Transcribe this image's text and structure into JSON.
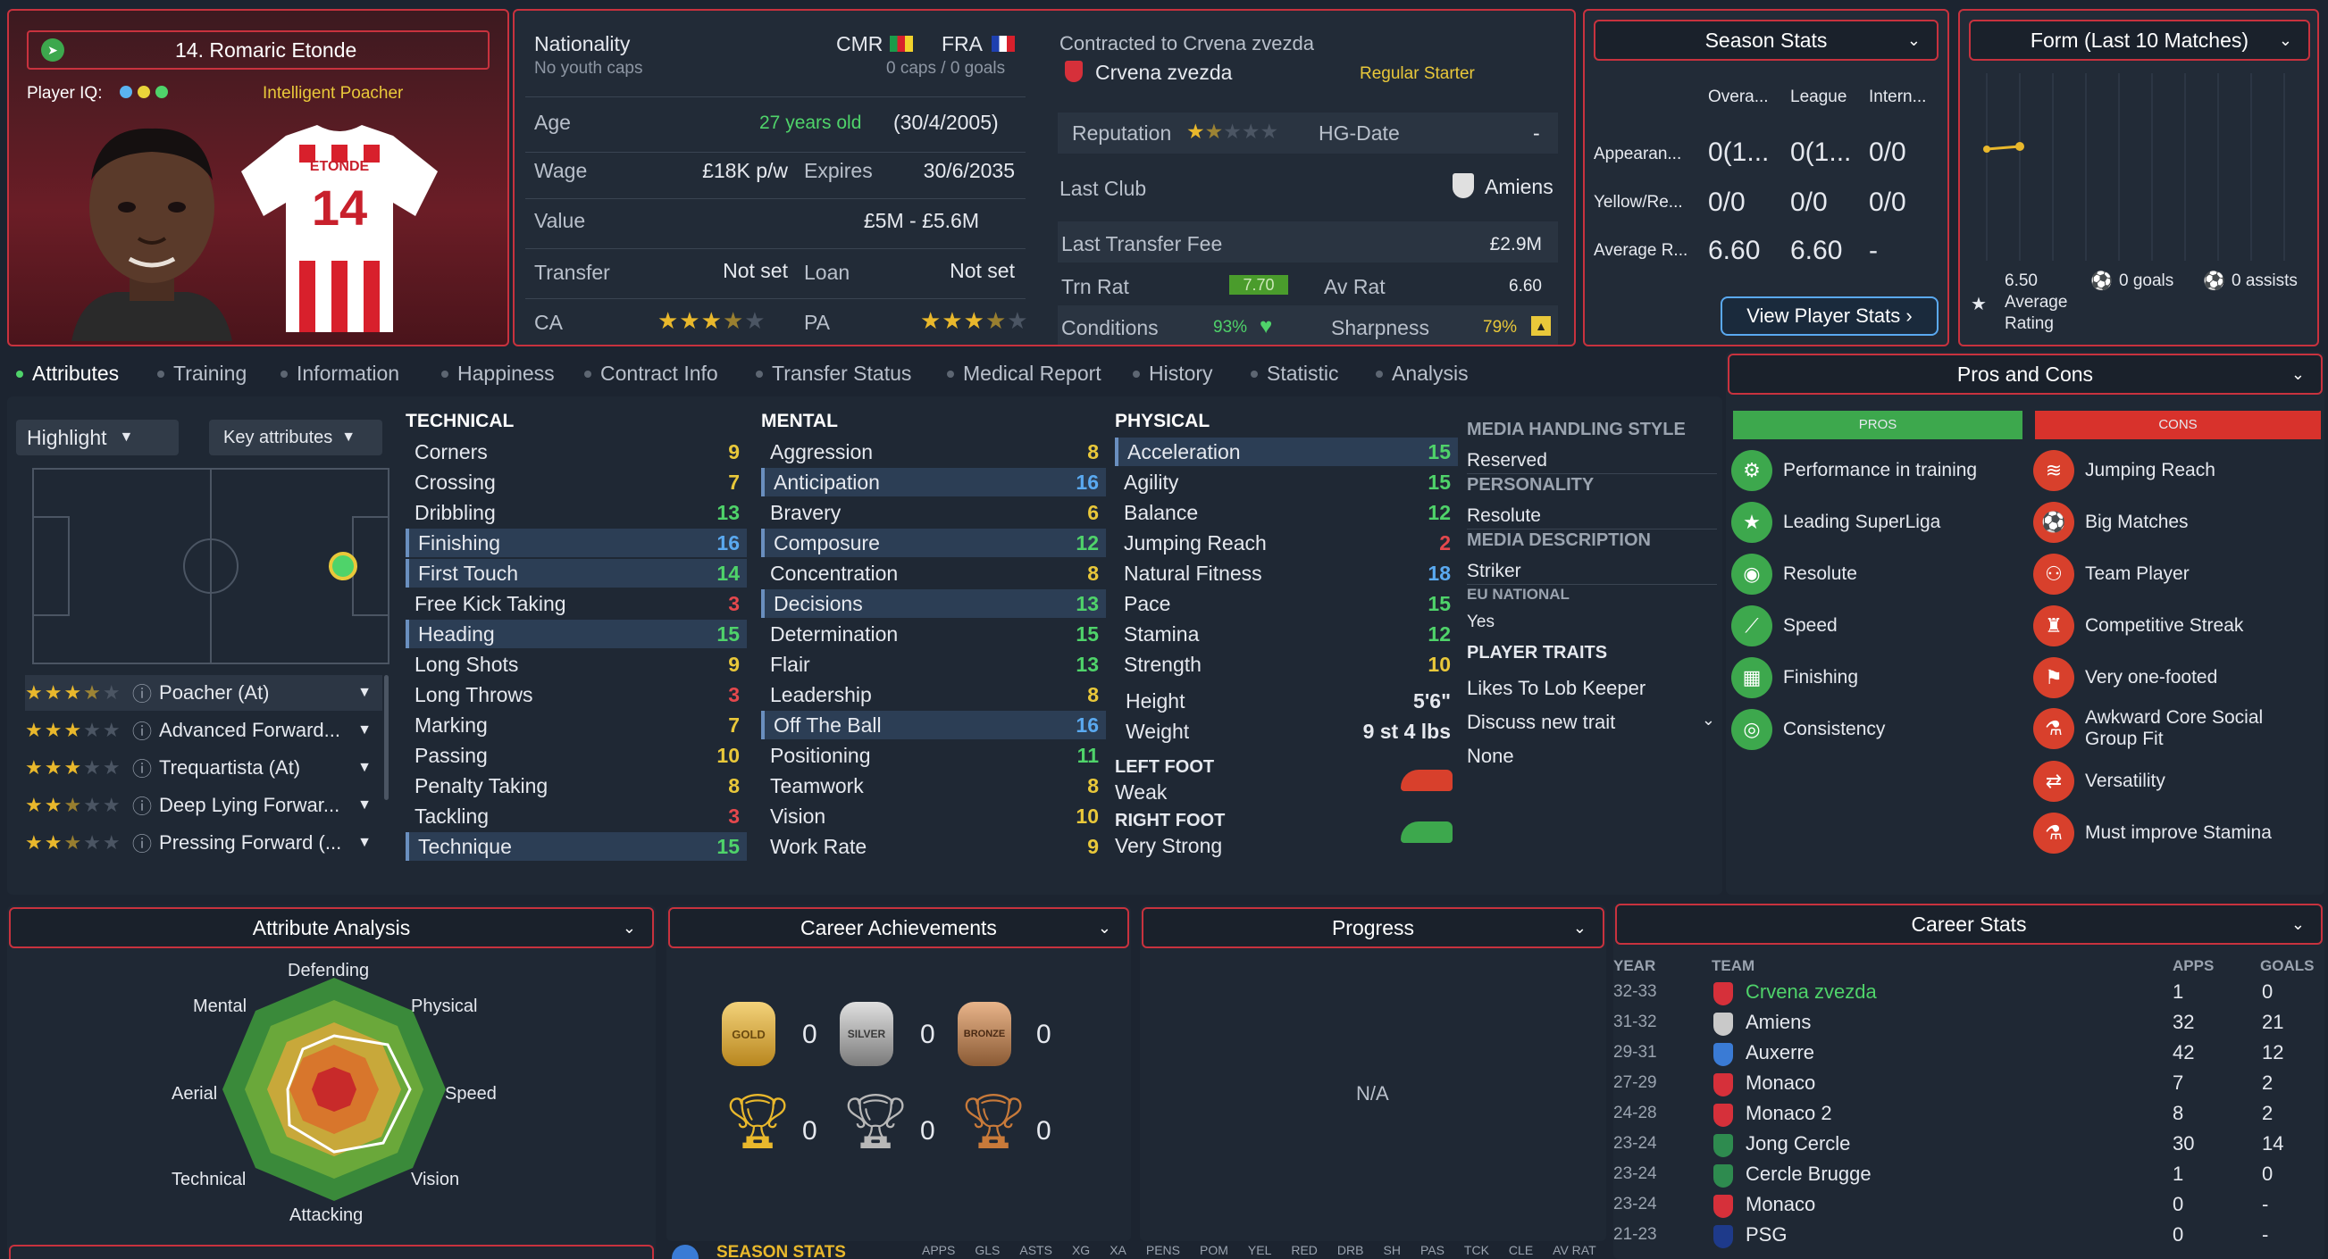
{
  "player": {
    "name": "14. Romaric Etonde",
    "player_iq_label": "Player IQ:",
    "iq_role": "Intelligent Poacher",
    "shirt_name": "ETONDE",
    "shirt_number": "14"
  },
  "bio": {
    "nationality_label": "Nationality",
    "youth_caps": "No youth caps",
    "nat1": "CMR",
    "nat2": "FRA",
    "caps": "0 caps / 0 goals",
    "age_label": "Age",
    "age": "27 years old",
    "dob": "(30/4/2005)",
    "wage_label": "Wage",
    "wage": "£18K p/w",
    "expires_label": "Expires",
    "expires": "30/6/2035",
    "value_label": "Value",
    "value": "£5M - £5.6M",
    "transfer_label": "Transfer",
    "transfer": "Not set",
    "loan_label": "Loan",
    "loan": "Not set",
    "ca_label": "CA",
    "ca_stars": 3.5,
    "pa_label": "PA",
    "pa_stars": 3.5
  },
  "contract": {
    "contracted_label": "Contracted to Crvena zvezda",
    "club": "Crvena zvezda",
    "status": "Regular Starter",
    "reputation_label": "Reputation",
    "reputation_stars": 1.5,
    "hg_label": "HG-Date",
    "hg_value": "-",
    "last_club_label": "Last Club",
    "last_club": "Amiens",
    "last_fee_label": "Last Transfer Fee",
    "last_fee": "£2.9M",
    "trn_rat_label": "Trn Rat",
    "trn_rat": "7.70",
    "av_rat_label": "Av Rat",
    "av_rat": "6.60",
    "conditions_label": "Conditions",
    "conditions": "93%",
    "sharpness_label": "Sharpness",
    "sharpness": "79%"
  },
  "season_stats": {
    "title": "Season Stats",
    "cols": [
      "Overa...",
      "League",
      "Intern..."
    ],
    "rows": [
      {
        "label": "Appearan...",
        "vals": [
          "0(1...",
          "0(1...",
          "0/0"
        ]
      },
      {
        "label": "Yellow/Re...",
        "vals": [
          "0/0",
          "0/0",
          "0/0"
        ]
      },
      {
        "label": "Average R...",
        "vals": [
          "6.60",
          "6.60",
          "-"
        ]
      }
    ],
    "button": "View Player Stats"
  },
  "form": {
    "title": "Form (Last 10 Matches)",
    "rating": "6.50",
    "rating_label1": "Average",
    "rating_label2": "Rating",
    "goals": "0 goals",
    "assists": "0 assists",
    "points": [
      6.5
    ]
  },
  "tabs": [
    "Attributes",
    "Training",
    "Information",
    "Happiness",
    "Contract Info",
    "Transfer Status",
    "Medical Report",
    "History",
    "Statistic",
    "Analysis"
  ],
  "controls": {
    "highlight": "Highlight",
    "key_attributes": "Key attributes"
  },
  "roles": [
    {
      "stars": 3.5,
      "name": "Poacher (At)"
    },
    {
      "stars": 3,
      "name": "Advanced Forward..."
    },
    {
      "stars": 3,
      "name": "Trequartista (At)"
    },
    {
      "stars": 2.5,
      "name": "Deep Lying Forwar..."
    },
    {
      "stars": 2.5,
      "name": "Pressing Forward (..."
    }
  ],
  "technical": {
    "title": "TECHNICAL",
    "items": [
      {
        "n": "Corners",
        "v": "9",
        "c": "y",
        "h": false
      },
      {
        "n": "Crossing",
        "v": "7",
        "c": "y",
        "h": false
      },
      {
        "n": "Dribbling",
        "v": "13",
        "c": "g",
        "h": false
      },
      {
        "n": "Finishing",
        "v": "16",
        "c": "b",
        "h": true
      },
      {
        "n": "First Touch",
        "v": "14",
        "c": "g",
        "h": true
      },
      {
        "n": "Free Kick Taking",
        "v": "3",
        "c": "r",
        "h": false
      },
      {
        "n": "Heading",
        "v": "15",
        "c": "g",
        "h": true
      },
      {
        "n": "Long Shots",
        "v": "9",
        "c": "y",
        "h": false
      },
      {
        "n": "Long Throws",
        "v": "3",
        "c": "r",
        "h": false
      },
      {
        "n": "Marking",
        "v": "7",
        "c": "y",
        "h": false
      },
      {
        "n": "Passing",
        "v": "10",
        "c": "y",
        "h": false
      },
      {
        "n": "Penalty Taking",
        "v": "8",
        "c": "y",
        "h": false
      },
      {
        "n": "Tackling",
        "v": "3",
        "c": "r",
        "h": false
      },
      {
        "n": "Technique",
        "v": "15",
        "c": "g",
        "h": true
      }
    ]
  },
  "mental": {
    "title": "MENTAL",
    "items": [
      {
        "n": "Aggression",
        "v": "8",
        "c": "y",
        "h": false
      },
      {
        "n": "Anticipation",
        "v": "16",
        "c": "b",
        "h": true
      },
      {
        "n": "Bravery",
        "v": "6",
        "c": "y",
        "h": false
      },
      {
        "n": "Composure",
        "v": "12",
        "c": "g",
        "h": true
      },
      {
        "n": "Concentration",
        "v": "8",
        "c": "y",
        "h": false
      },
      {
        "n": "Decisions",
        "v": "13",
        "c": "g",
        "h": true
      },
      {
        "n": "Determination",
        "v": "15",
        "c": "g",
        "h": false
      },
      {
        "n": "Flair",
        "v": "13",
        "c": "g",
        "h": false
      },
      {
        "n": "Leadership",
        "v": "8",
        "c": "y",
        "h": false
      },
      {
        "n": "Off The Ball",
        "v": "16",
        "c": "b",
        "h": true
      },
      {
        "n": "Positioning",
        "v": "11",
        "c": "g",
        "h": false
      },
      {
        "n": "Teamwork",
        "v": "8",
        "c": "y",
        "h": false
      },
      {
        "n": "Vision",
        "v": "10",
        "c": "y",
        "h": false
      },
      {
        "n": "Work Rate",
        "v": "9",
        "c": "y",
        "h": false
      }
    ]
  },
  "physical": {
    "title": "PHYSICAL",
    "items": [
      {
        "n": "Acceleration",
        "v": "15",
        "c": "g",
        "h": true
      },
      {
        "n": "Agility",
        "v": "15",
        "c": "g",
        "h": false
      },
      {
        "n": "Balance",
        "v": "12",
        "c": "g",
        "h": false
      },
      {
        "n": "Jumping Reach",
        "v": "2",
        "c": "r",
        "h": false
      },
      {
        "n": "Natural Fitness",
        "v": "18",
        "c": "b",
        "h": false
      },
      {
        "n": "Pace",
        "v": "15",
        "c": "g",
        "h": false
      },
      {
        "n": "Stamina",
        "v": "12",
        "c": "g",
        "h": false
      },
      {
        "n": "Strength",
        "v": "10",
        "c": "y",
        "h": false
      }
    ],
    "height_label": "Height",
    "height": "5'6\"",
    "weight_label": "Weight",
    "weight": "9 st 4 lbs",
    "left_foot_label": "LEFT FOOT",
    "left_foot": "Weak",
    "right_foot_label": "RIGHT FOOT",
    "right_foot": "Very Strong"
  },
  "info": {
    "media_style_label": "MEDIA HANDLING STYLE",
    "media_style": "Reserved",
    "personality_label": "PERSONALITY",
    "personality": "Resolute",
    "media_desc_label": "MEDIA DESCRIPTION",
    "media_desc": "Striker",
    "eu_label": "EU NATIONAL",
    "eu": "Yes",
    "traits_label": "PLAYER TRAITS",
    "trait1": "Likes To Lob Keeper",
    "discuss": "Discuss new trait",
    "trait2": "None"
  },
  "pros_cons": {
    "title": "Pros and Cons",
    "pros_label": "PROS",
    "cons_label": "CONS",
    "pros": [
      "Performance in training",
      "Leading SuperLiga",
      "Resolute",
      "Speed",
      "Finishing",
      "Consistency"
    ],
    "cons": [
      "Jumping Reach",
      "Big Matches",
      "Team Player",
      "Competitive Streak",
      "Very one-footed",
      "Awkward Core Social Group Fit",
      "Versatility",
      "Must improve Stamina"
    ]
  },
  "analysis": {
    "title": "Attribute Analysis",
    "labels": [
      "Defending",
      "Physical",
      "Speed",
      "Vision",
      "Attacking",
      "Technical",
      "Aerial",
      "Mental"
    ]
  },
  "achievements": {
    "title": "Career Achievements",
    "gold": "0",
    "silver": "0",
    "bronze": "0",
    "cup_gold": "0",
    "cup_silver": "0",
    "cup_bronze": "0",
    "gold_label": "GOLD",
    "silver_label": "SILVER",
    "bronze_label": "BRONZE"
  },
  "progress": {
    "title": "Progress",
    "na": "N/A"
  },
  "career": {
    "title": "Career Stats",
    "headers": [
      "YEAR",
      "TEAM",
      "APPS",
      "GOALS"
    ],
    "rows": [
      {
        "year": "32-33",
        "team": "Crvena zvezda",
        "apps": "1",
        "goals": "0",
        "color": "#d6303a",
        "hl": true
      },
      {
        "year": "31-32",
        "team": "Amiens",
        "apps": "32",
        "goals": "21",
        "color": "#c9c9c9",
        "hl": false
      },
      {
        "year": "29-31",
        "team": "Auxerre",
        "apps": "42",
        "goals": "12",
        "color": "#3a7bd5",
        "hl": false
      },
      {
        "year": "27-29",
        "team": "Monaco",
        "apps": "7",
        "goals": "2",
        "color": "#d6303a",
        "hl": false
      },
      {
        "year": "24-28",
        "team": "Monaco 2",
        "apps": "8",
        "goals": "2",
        "color": "#d6303a",
        "hl": false
      },
      {
        "year": "23-24",
        "team": "Jong Cercle",
        "apps": "30",
        "goals": "14",
        "color": "#2e8b4f",
        "hl": false
      },
      {
        "year": "23-24",
        "team": "Cercle Brugge",
        "apps": "1",
        "goals": "0",
        "color": "#2e8b4f",
        "hl": false
      },
      {
        "year": "23-24",
        "team": "Monaco",
        "apps": "0",
        "goals": "-",
        "color": "#d6303a",
        "hl": false
      },
      {
        "year": "21-23",
        "team": "PSG",
        "apps": "0",
        "goals": "-",
        "color": "#1e3a8a",
        "hl": false
      }
    ]
  },
  "footer": {
    "season_stats": "SEASON STATS",
    "cols": [
      "APPS",
      "GLS",
      "ASTS",
      "XG",
      "XA",
      "PENS",
      "POM",
      "YEL",
      "RED",
      "DRB",
      "SH",
      "PAS",
      "TCK",
      "CLE",
      "AV RAT"
    ]
  }
}
